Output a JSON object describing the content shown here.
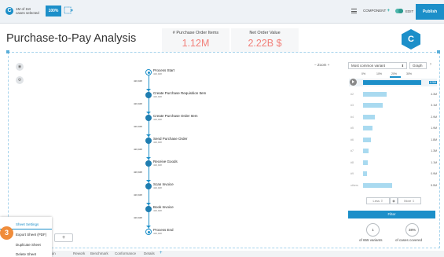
{
  "topbar": {
    "cases_selected_count": "1M of 1M",
    "cases_selected_label": "cases selected",
    "percent_badge": "100%",
    "component_label": "COMPONENT",
    "component_plus": "+",
    "edit_label": "EDIT",
    "publish_label": "Publish"
  },
  "header": {
    "title": "Purchase-to-Pay Analysis",
    "kpis": [
      {
        "title": "# Purchase Order Items",
        "value": "1.12M"
      },
      {
        "title": "Net Order Value",
        "value": "2.22B $"
      }
    ],
    "logo_letter": "C"
  },
  "process": {
    "activities": [
      {
        "label": "Process Start",
        "count": "420,948"
      },
      {
        "label": "Create Purchase Requisition Item",
        "count": "420,948"
      },
      {
        "label": "Create Purchase Order Item",
        "count": "420,948"
      },
      {
        "label": "Send Purchase Order",
        "count": "420,948"
      },
      {
        "label": "Receive Goods",
        "count": "420,948"
      },
      {
        "label": "Scan Invoice",
        "count": "420,948"
      },
      {
        "label": "Book Invoice",
        "count": "420,948"
      },
      {
        "label": "Process End",
        "count": "420,948"
      }
    ],
    "edge_counts": [
      "420,948",
      "420,948",
      "420,948",
      "420,948",
      "420,948",
      "420,948",
      "420,948"
    ]
  },
  "zoom": {
    "minus": "−",
    "label": "Zoom",
    "plus": "+"
  },
  "variants_panel": {
    "variant_select": "Most common variant",
    "view_select": "Graph",
    "axis_ticks": [
      "0%",
      "10%",
      "20%",
      "30%"
    ],
    "rows": [
      {
        "label": "#1",
        "value": 0.3,
        "count": "8.5M",
        "selected": true
      },
      {
        "label": "#2",
        "value": 0.12,
        "count": "4.3M"
      },
      {
        "label": "#3",
        "value": 0.1,
        "count": "3.1M"
      },
      {
        "label": "#4",
        "value": 0.06,
        "count": "2.9M"
      },
      {
        "label": "#5",
        "value": 0.05,
        "count": "1.9M"
      },
      {
        "label": "#6",
        "value": 0.04,
        "count": "1.8M"
      },
      {
        "label": "#7",
        "value": 0.03,
        "count": "1.3M"
      },
      {
        "label": "#8",
        "value": 0.025,
        "count": "1.1M"
      },
      {
        "label": "#9",
        "value": 0.02,
        "count": "0.9M"
      },
      {
        "label": "others",
        "value": 0.15,
        "count": "5.5M"
      }
    ],
    "less_label": "Less",
    "more_label": "More",
    "filter_label": "Filter",
    "variants_count": "1",
    "variants_text": "of 655 variants",
    "cases_covered_pct": "38%",
    "cases_covered_text": "of cases covered"
  },
  "sheet_menu": {
    "items": [
      "Sheet Settings",
      "Export Sheet (PDF)",
      "Duplicate Sheet",
      "Delete Sheet"
    ],
    "step_badge": "3",
    "add_sheet": "+"
  },
  "tabs": [
    "Pro",
    "Automation",
    "Rework",
    "Benchmark",
    "Conformance",
    "Details"
  ],
  "tab_add": "+"
}
